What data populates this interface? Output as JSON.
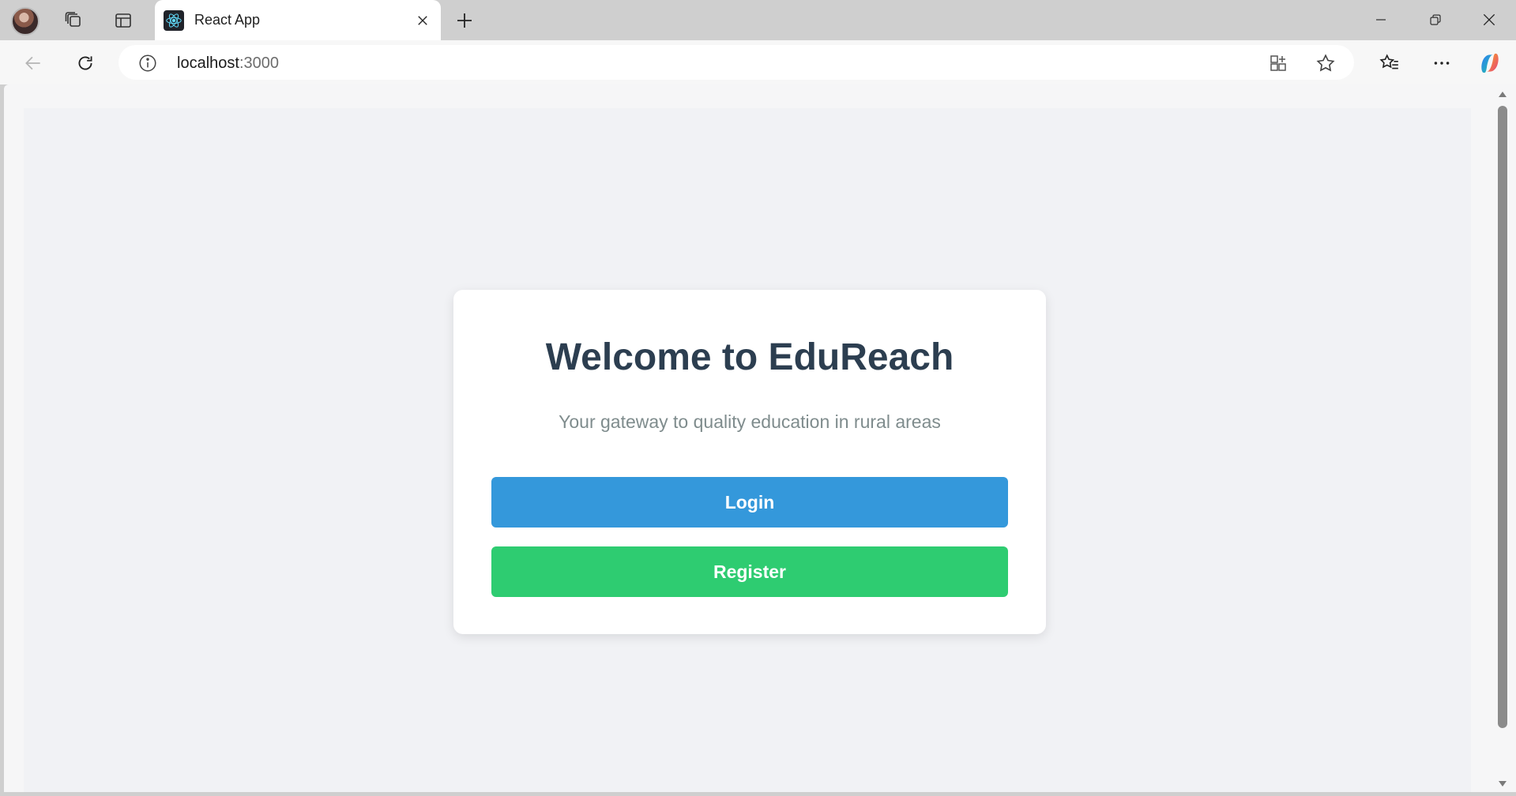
{
  "browser": {
    "tab": {
      "title": "React App"
    },
    "address": {
      "host": "localhost",
      "port": ":3000"
    }
  },
  "page": {
    "title": "Welcome to EduReach",
    "subtitle": "Your gateway to quality education in rural areas",
    "login_label": "Login",
    "register_label": "Register"
  },
  "colors": {
    "heading": "#2c3e50",
    "subtitle": "#7f8c8d",
    "login": "#3498db",
    "register": "#2ecc71",
    "page_bg": "#f1f2f5"
  },
  "icons": [
    "profile-avatar",
    "workspaces-icon",
    "vertical-tabs-icon",
    "react-favicon-icon",
    "close-icon",
    "plus-icon",
    "minimize-icon",
    "restore-icon",
    "close-window-icon",
    "back-arrow-icon",
    "refresh-icon",
    "info-icon",
    "app-available-icon",
    "star-icon",
    "favorites-icon",
    "more-icon",
    "copilot-icon"
  ]
}
